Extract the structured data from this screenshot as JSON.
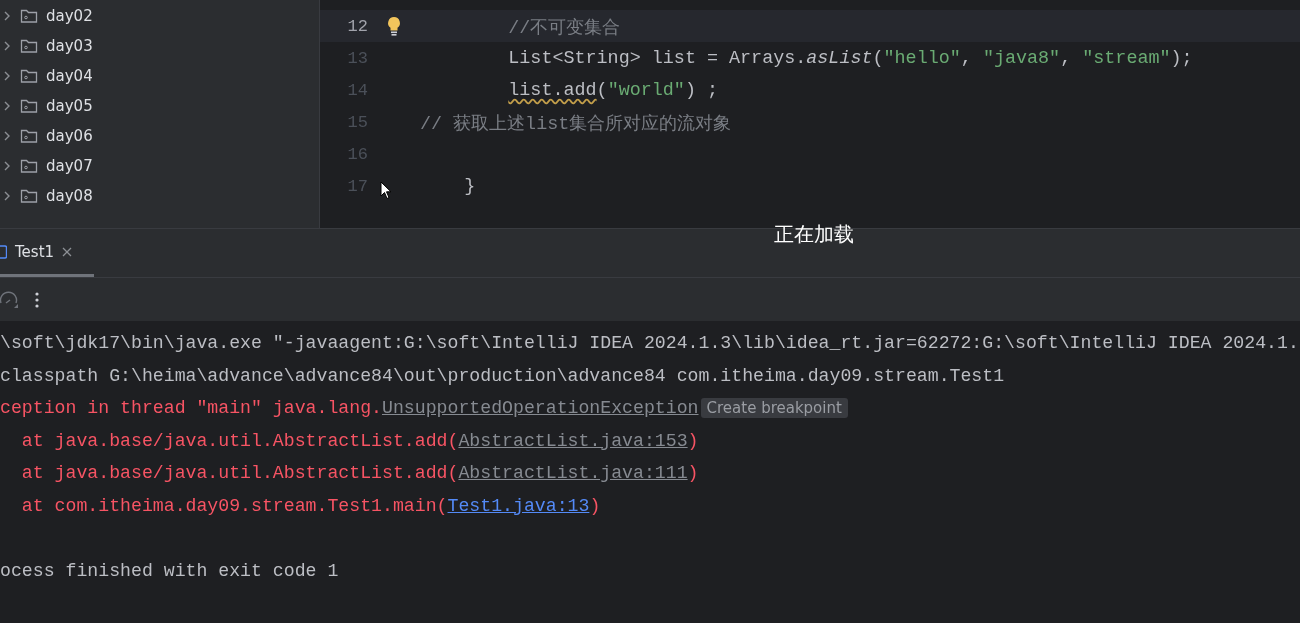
{
  "project_tree": [
    {
      "label": "day02",
      "expanded": false
    },
    {
      "label": "day03",
      "expanded": false
    },
    {
      "label": "day04",
      "expanded": false
    },
    {
      "label": "day05",
      "expanded": false
    },
    {
      "label": "day06",
      "expanded": false
    },
    {
      "label": "day07",
      "expanded": false
    },
    {
      "label": "day08",
      "expanded": false
    }
  ],
  "editor": {
    "lines": [
      {
        "number": "12",
        "current": true,
        "bulb": true,
        "tokens": [
          {
            "kind": "comment",
            "text": "        //不可变集合"
          }
        ]
      },
      {
        "number": "13",
        "current": false,
        "bulb": false,
        "tokens": [
          {
            "kind": "plain",
            "text": "        List<String> list = Arrays."
          },
          {
            "kind": "static",
            "text": "asList"
          },
          {
            "kind": "plain",
            "text": "("
          },
          {
            "kind": "string",
            "text": "\"hello\""
          },
          {
            "kind": "plain",
            "text": ", "
          },
          {
            "kind": "string",
            "text": "\"java8\""
          },
          {
            "kind": "plain",
            "text": ", "
          },
          {
            "kind": "string",
            "text": "\"stream\""
          },
          {
            "kind": "plain",
            "text": ");"
          }
        ]
      },
      {
        "number": "14",
        "current": false,
        "bulb": false,
        "tokens": [
          {
            "kind": "warning",
            "text": "        list.add"
          },
          {
            "kind": "plain",
            "text": "("
          },
          {
            "kind": "string",
            "text": "\"world\""
          },
          {
            "kind": "plain",
            "text": ") ;"
          }
        ]
      },
      {
        "number": "15",
        "current": false,
        "bulb": false,
        "tokens": [
          {
            "kind": "comment",
            "text": "// 获取上述list集合所对应的流对象"
          }
        ]
      },
      {
        "number": "16",
        "current": false,
        "bulb": false
      },
      {
        "number": "17",
        "current": false,
        "bulb": false,
        "tokens": [
          {
            "kind": "plain",
            "text": "    }"
          }
        ]
      }
    ]
  },
  "loading_text": "正在加载",
  "run_tabs": [
    {
      "label": "Test1",
      "selected": true
    }
  ],
  "console": [
    {
      "segments": [
        {
          "kind": "normal",
          "text": "\\soft\\jdk17\\bin\\java.exe \"-javaagent:G:\\soft\\IntelliJ IDEA 2024.1.3\\lib\\idea_rt.jar=62272:G:\\soft\\IntelliJ IDEA 2024.1."
        }
      ]
    },
    {
      "segments": [
        {
          "kind": "normal",
          "text": "classpath G:\\heima\\advance\\advance84\\out\\production\\advance84 com.itheima.day09.stream.Test1"
        }
      ]
    },
    {
      "segments": [
        {
          "kind": "error",
          "text": "ception in thread \"main\" java.lang."
        },
        {
          "kind": "link",
          "text": "UnsupportedOperationException"
        },
        {
          "kind": "hint",
          "text": "Create breakpoint"
        }
      ]
    },
    {
      "segments": [
        {
          "kind": "error",
          "text": "  at java.base/java.util.AbstractList.add("
        },
        {
          "kind": "link",
          "text": "AbstractList.java:153"
        },
        {
          "kind": "error",
          "text": ")"
        }
      ]
    },
    {
      "segments": [
        {
          "kind": "error",
          "text": "  at java.base/java.util.AbstractList.add("
        },
        {
          "kind": "link",
          "text": "AbstractList.java:111"
        },
        {
          "kind": "error",
          "text": ")"
        }
      ]
    },
    {
      "segments": [
        {
          "kind": "error",
          "text": "  at com.itheima.day09.stream.Test1.main("
        },
        {
          "kind": "source_link",
          "text": "Test1.java:13"
        },
        {
          "kind": "error",
          "text": ")"
        }
      ]
    },
    {
      "kind": "exit_status",
      "segments": [
        {
          "kind": "normal",
          "text": "ocess finished with exit code 1"
        }
      ]
    }
  ]
}
